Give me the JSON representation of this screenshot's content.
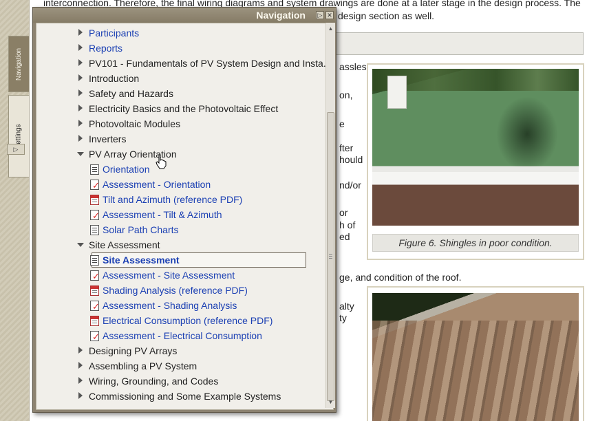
{
  "content": {
    "text_top_line": "interconnection. Therefore, the final wiring diagrams and system drawings are done at a later stage in the design process. The",
    "text_second_line": "design section as well.",
    "fragments": [
      "assles",
      "on,",
      "e",
      "fter",
      "hould",
      "nd/or",
      "or",
      "h of",
      "ed"
    ],
    "bottom_line": "ge, and condition of the roof.",
    "lower_fragments": [
      "alty",
      "ty"
    ],
    "figure_caption": "Figure 6. Shingles in poor condition."
  },
  "side_tabs": {
    "navigation_label": "Navigation",
    "settings_label": "Settings",
    "expand_glyph": "▷"
  },
  "nav_panel": {
    "title": "Navigation",
    "pin_glyph": "▷",
    "close_glyph": "✕",
    "items": [
      {
        "label": "Participants",
        "type": "link",
        "state": "collapsed"
      },
      {
        "label": "Reports",
        "type": "link",
        "state": "collapsed"
      },
      {
        "label": "PV101 - Fundamentals of PV System Design and Insta...",
        "type": "plain",
        "state": "collapsed"
      },
      {
        "label": "Introduction",
        "type": "plain",
        "state": "collapsed"
      },
      {
        "label": "Safety and Hazards",
        "type": "plain",
        "state": "collapsed"
      },
      {
        "label": "Electricity Basics and the Photovoltaic Effect",
        "type": "plain",
        "state": "collapsed"
      },
      {
        "label": "Photovoltaic Modules",
        "type": "plain",
        "state": "collapsed"
      },
      {
        "label": "Inverters",
        "type": "plain",
        "state": "collapsed"
      },
      {
        "label": "PV Array Orientation",
        "type": "plain",
        "state": "expanded",
        "children": [
          {
            "label": "Orientation",
            "icon": "page"
          },
          {
            "label": "Assessment - Orientation",
            "icon": "check"
          },
          {
            "label": "Tilt and Azimuth (reference PDF)",
            "icon": "pdf"
          },
          {
            "label": "Assessment - Tilt & Azimuth",
            "icon": "check"
          },
          {
            "label": "Solar Path Charts",
            "icon": "page"
          }
        ]
      },
      {
        "label": "Site Assessment",
        "type": "plain",
        "state": "expanded",
        "children": [
          {
            "label": "Site Assessment",
            "icon": "page",
            "selected": true
          },
          {
            "label": "Assessment - Site Assessment",
            "icon": "check"
          },
          {
            "label": "Shading Analysis (reference PDF)",
            "icon": "pdf"
          },
          {
            "label": "Assessment - Shading Analysis",
            "icon": "check"
          },
          {
            "label": "Electrical Consumption (reference PDF)",
            "icon": "pdf"
          },
          {
            "label": "Assessment - Electrical Consumption",
            "icon": "check"
          }
        ]
      },
      {
        "label": "Designing PV Arrays",
        "type": "plain",
        "state": "collapsed"
      },
      {
        "label": "Assembling a PV System",
        "type": "plain",
        "state": "collapsed"
      },
      {
        "label": "Wiring, Grounding, and Codes",
        "type": "plain",
        "state": "collapsed"
      },
      {
        "label": "Commissioning and Some Example Systems",
        "type": "plain",
        "state": "collapsed"
      }
    ]
  },
  "colors": {
    "link": "#1a3fb3",
    "panel_frame": "#8c8270",
    "panel_body": "#f1efea"
  }
}
